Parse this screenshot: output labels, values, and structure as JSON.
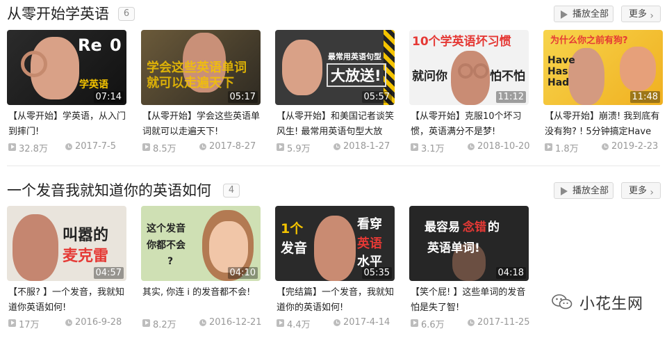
{
  "sections": [
    {
      "title": "从零开始学英语",
      "count": "6",
      "play_all": "播放全部",
      "more": "更多",
      "videos": [
        {
          "title": "【从零开始】学英语，从入门到摔门!",
          "duration": "07:14",
          "views": "32.8万",
          "date": "2017-7-5",
          "thumb_text": [
            "Re",
            "0",
            "学英语"
          ]
        },
        {
          "title": "【从零开始】学会这些英语单词就可以走遍天下!",
          "duration": "05:17",
          "views": "8.5万",
          "date": "2017-8-27",
          "thumb_text": [
            "学会这些英语单词",
            "就可以走遍天下"
          ]
        },
        {
          "title": "【从零开始】和美国记者谈笑风生! 最常用英语句型大放",
          "duration": "05:57",
          "views": "5.9万",
          "date": "2018-1-27",
          "thumb_text": [
            "最常用英语句型",
            "大放送!"
          ]
        },
        {
          "title": "【从零开始】克服10个坏习惯，英语满分不是梦!",
          "duration": "11:12",
          "views": "3.1万",
          "date": "2018-10-20",
          "thumb_text": [
            "10个学英语坏习惯",
            "就问你",
            "怕不怕"
          ]
        },
        {
          "title": "【从零开始】崩溃! 我到底有没有狗? ! 5分钟搞定Have",
          "duration": "11:48",
          "views": "1.8万",
          "date": "2019-2-23",
          "thumb_text": [
            "为什么你之前有狗?",
            "Have",
            "Has",
            "Had"
          ]
        }
      ]
    },
    {
      "title": "一个发音我就知道你的英语如何",
      "count": "4",
      "play_all": "播放全部",
      "more": "更多",
      "videos": [
        {
          "title": "【不服? 】一个发音，我就知道你英语如何!",
          "duration": "04:57",
          "views": "17万",
          "date": "2016-9-28",
          "thumb_text": [
            "叫嚣的",
            "麦克雷"
          ]
        },
        {
          "title": "其实, 你连 i 的发音都不会!",
          "duration": "04:10",
          "views": "8.2万",
          "date": "2016-12-21",
          "thumb_text": [
            "这个发音",
            "你都不会",
            "?"
          ]
        },
        {
          "title": "【完结篇】一个发音，我就知道你的英语如何!",
          "duration": "05:35",
          "views": "4.4万",
          "date": "2017-4-14",
          "thumb_text": [
            "1个",
            "发音",
            "看穿",
            "英语",
            "水平"
          ]
        },
        {
          "title": "【笑个屁! 】这些单词的发音怕是失了智!",
          "duration": "04:18",
          "views": "6.6万",
          "date": "2017-11-25",
          "thumb_text": [
            "最容易",
            "念错",
            "的",
            "英语单词!"
          ]
        }
      ]
    }
  ],
  "watermark": "小花生网",
  "colors": {
    "accent_yellow": "#f5c400",
    "accent_red": "#e53935",
    "meta_gray": "#999999"
  }
}
